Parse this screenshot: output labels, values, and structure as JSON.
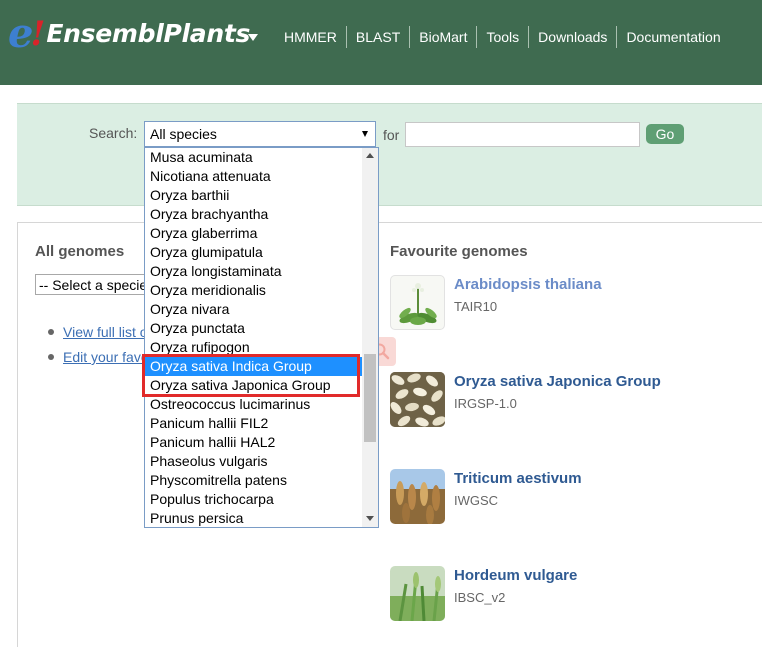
{
  "header": {
    "logo_e": "e",
    "logo_bang": "!",
    "logo_text": "EnsemblPlants",
    "nav": [
      "HMMER",
      "BLAST",
      "BioMart",
      "Tools",
      "Downloads",
      "Documentation"
    ]
  },
  "search": {
    "label": "Search:",
    "selected_species": "All species",
    "for_label": "for",
    "query_value": "",
    "go_label": "Go"
  },
  "species_dropdown": {
    "options": [
      "Musa acuminata",
      "Nicotiana attenuata",
      "Oryza barthii",
      "Oryza brachyantha",
      "Oryza glaberrima",
      "Oryza glumipatula",
      "Oryza longistaminata",
      "Oryza meridionalis",
      "Oryza nivara",
      "Oryza punctata",
      "Oryza rufipogon",
      "Oryza sativa Indica Group",
      "Oryza sativa Japonica Group",
      "Ostreococcus lucimarinus",
      "Panicum hallii FIL2",
      "Panicum hallii HAL2",
      "Phaseolus vulgaris",
      "Physcomitrella patens",
      "Populus trichocarpa",
      "Prunus persica"
    ],
    "hovered_option": "Oryza sativa Indica Group",
    "annotated_options": [
      "Oryza sativa Indica Group",
      "Oryza sativa Japonica Group"
    ]
  },
  "all_genomes": {
    "heading": "All genomes",
    "select_placeholder": "-- Select a species --",
    "links": [
      "View full list of all species",
      "Edit your favourites"
    ]
  },
  "favourites": {
    "heading": "Favourite genomes",
    "items": [
      {
        "name": "Arabidopsis thaliana",
        "assembly": "TAIR10",
        "name_color": "#6b8cc8"
      },
      {
        "name": "Oryza sativa Japonica Group",
        "assembly": "IRGSP-1.0",
        "name_color": "#2f5a92"
      },
      {
        "name": "Triticum aestivum",
        "assembly": "IWGSC",
        "name_color": "#2f5a92"
      },
      {
        "name": "Hordeum vulgare",
        "assembly": "IBSC_v2",
        "name_color": "#2f5a92"
      }
    ]
  },
  "colors": {
    "header_bg": "#3f6b50",
    "search_band_bg": "#dbeee3",
    "go_button": "#5f9f74",
    "selected_option": "#1e90ff",
    "annotation_box": "#e12a2a",
    "link": "#3c6fb4"
  }
}
